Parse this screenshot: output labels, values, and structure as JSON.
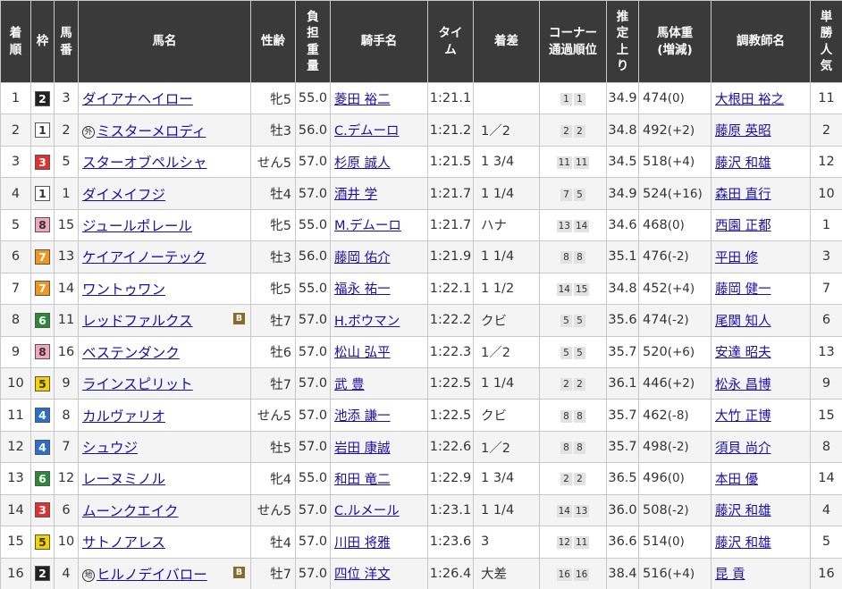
{
  "columns": [
    {
      "label": "着\n順"
    },
    {
      "label": "枠"
    },
    {
      "label": "馬\n番"
    },
    {
      "label": "馬名"
    },
    {
      "label": "性齢"
    },
    {
      "label": "負\n担\n重\n量"
    },
    {
      "label": "騎手名"
    },
    {
      "label": "タイ\nム"
    },
    {
      "label": "着差"
    },
    {
      "label": "コーナー\n通過順位"
    },
    {
      "label": "推\n定\n上\nり"
    },
    {
      "label": "馬体重\n(増減)"
    },
    {
      "label": "調教師名"
    },
    {
      "label": "単\n勝\n人\n気"
    }
  ],
  "frame_colors": {
    "1": {
      "bg": "#ffffff",
      "fg": "#333333"
    },
    "2": {
      "bg": "#222222",
      "fg": "#ffffff"
    },
    "3": {
      "bg": "#e03030",
      "fg": "#ffffff"
    },
    "4": {
      "bg": "#2a70c8",
      "fg": "#ffffff"
    },
    "5": {
      "bg": "#f2d300",
      "fg": "#333333"
    },
    "6": {
      "bg": "#2a8a3a",
      "fg": "#ffffff"
    },
    "7": {
      "bg": "#f0961e",
      "fg": "#ffffff"
    },
    "8": {
      "bg": "#f5a6bf",
      "fg": "#333333"
    }
  },
  "rows": [
    {
      "rank": "1",
      "frame": "2",
      "num": "3",
      "mark": "",
      "horse": "ダイアナヘイロー",
      "blinker": "",
      "sexage": "牝5",
      "weight": "55.0",
      "jockey": "菱田 裕二",
      "time": "1:21.1",
      "diff": "",
      "corner": [
        "1",
        "1"
      ],
      "last3f": "34.9",
      "body": "474",
      "bodydiff": "(0)",
      "trainer": "大根田 裕之",
      "pop": "11"
    },
    {
      "rank": "2",
      "frame": "1",
      "num": "2",
      "mark": "外",
      "horse": "ミスターメロディ",
      "blinker": "",
      "sexage": "牡3",
      "weight": "56.0",
      "jockey": "C.デムーロ",
      "time": "1:21.2",
      "diff": "1／2",
      "corner": [
        "2",
        "2"
      ],
      "last3f": "34.8",
      "body": "492",
      "bodydiff": "(+2)",
      "trainer": "藤原 英昭",
      "pop": "2"
    },
    {
      "rank": "3",
      "frame": "3",
      "num": "5",
      "mark": "",
      "horse": "スターオブペルシャ",
      "blinker": "",
      "sexage": "せん5",
      "weight": "57.0",
      "jockey": "杉原 誠人",
      "time": "1:21.5",
      "diff": "1 3/4",
      "corner": [
        "11",
        "11"
      ],
      "last3f": "34.5",
      "body": "518",
      "bodydiff": "(+4)",
      "trainer": "藤沢 和雄",
      "pop": "12"
    },
    {
      "rank": "4",
      "frame": "1",
      "num": "1",
      "mark": "",
      "horse": "ダイメイフジ",
      "blinker": "",
      "sexage": "牡4",
      "weight": "57.0",
      "jockey": "酒井 学",
      "time": "1:21.7",
      "diff": "1 1/4",
      "corner": [
        "7",
        "5"
      ],
      "last3f": "34.9",
      "body": "524",
      "bodydiff": "(+16)",
      "trainer": "森田 直行",
      "pop": "10"
    },
    {
      "rank": "5",
      "frame": "8",
      "num": "15",
      "mark": "",
      "horse": "ジュールポレール",
      "blinker": "",
      "sexage": "牝5",
      "weight": "55.0",
      "jockey": "M.デムーロ",
      "time": "1:21.7",
      "diff": "ハナ",
      "corner": [
        "13",
        "14"
      ],
      "last3f": "34.6",
      "body": "468",
      "bodydiff": "(0)",
      "trainer": "西園 正都",
      "pop": "1"
    },
    {
      "rank": "6",
      "frame": "7",
      "num": "13",
      "mark": "",
      "horse": "ケイアイノーテック",
      "blinker": "",
      "sexage": "牡3",
      "weight": "56.0",
      "jockey": "藤岡 佑介",
      "time": "1:21.9",
      "diff": "1 1/4",
      "corner": [
        "8",
        "8"
      ],
      "last3f": "35.1",
      "body": "476",
      "bodydiff": "(-2)",
      "trainer": "平田 修",
      "pop": "3"
    },
    {
      "rank": "7",
      "frame": "7",
      "num": "14",
      "mark": "",
      "horse": "ワントゥワン",
      "blinker": "",
      "sexage": "牝5",
      "weight": "55.0",
      "jockey": "福永 祐一",
      "time": "1:22.1",
      "diff": "1 1/2",
      "corner": [
        "14",
        "15"
      ],
      "last3f": "34.8",
      "body": "452",
      "bodydiff": "(+4)",
      "trainer": "藤岡 健一",
      "pop": "7"
    },
    {
      "rank": "8",
      "frame": "6",
      "num": "11",
      "mark": "",
      "horse": "レッドファルクス",
      "blinker": "B",
      "sexage": "牡7",
      "weight": "57.0",
      "jockey": "H.ボウマン",
      "time": "1:22.2",
      "diff": "クビ",
      "corner": [
        "5",
        "5"
      ],
      "last3f": "35.6",
      "body": "474",
      "bodydiff": "(-2)",
      "trainer": "尾関 知人",
      "pop": "6"
    },
    {
      "rank": "9",
      "frame": "8",
      "num": "16",
      "mark": "",
      "horse": "ベステンダンク",
      "blinker": "",
      "sexage": "牡6",
      "weight": "57.0",
      "jockey": "松山 弘平",
      "time": "1:22.3",
      "diff": "1／2",
      "corner": [
        "5",
        "5"
      ],
      "last3f": "35.7",
      "body": "520",
      "bodydiff": "(+6)",
      "trainer": "安達 昭夫",
      "pop": "13"
    },
    {
      "rank": "10",
      "frame": "5",
      "num": "9",
      "mark": "",
      "horse": "ラインスピリット",
      "blinker": "",
      "sexage": "牡7",
      "weight": "57.0",
      "jockey": "武 豊",
      "time": "1:22.5",
      "diff": "1 1/4",
      "corner": [
        "2",
        "2"
      ],
      "last3f": "36.1",
      "body": "446",
      "bodydiff": "(+2)",
      "trainer": "松永 昌博",
      "pop": "9"
    },
    {
      "rank": "11",
      "frame": "4",
      "num": "8",
      "mark": "",
      "horse": "カルヴァリオ",
      "blinker": "",
      "sexage": "せん5",
      "weight": "57.0",
      "jockey": "池添 謙一",
      "time": "1:22.5",
      "diff": "クビ",
      "corner": [
        "8",
        "8"
      ],
      "last3f": "35.7",
      "body": "462",
      "bodydiff": "(-8)",
      "trainer": "大竹 正博",
      "pop": "15"
    },
    {
      "rank": "12",
      "frame": "4",
      "num": "7",
      "mark": "",
      "horse": "シュウジ",
      "blinker": "",
      "sexage": "牡5",
      "weight": "57.0",
      "jockey": "岩田 康誠",
      "time": "1:22.6",
      "diff": "1／2",
      "corner": [
        "8",
        "8"
      ],
      "last3f": "35.7",
      "body": "498",
      "bodydiff": "(-2)",
      "trainer": "須貝 尚介",
      "pop": "8"
    },
    {
      "rank": "13",
      "frame": "6",
      "num": "12",
      "mark": "",
      "horse": "レーヌミノル",
      "blinker": "",
      "sexage": "牝4",
      "weight": "55.0",
      "jockey": "和田 竜二",
      "time": "1:22.9",
      "diff": "1 3/4",
      "corner": [
        "2",
        "2"
      ],
      "last3f": "36.5",
      "body": "496",
      "bodydiff": "(0)",
      "trainer": "本田 優",
      "pop": "14"
    },
    {
      "rank": "14",
      "frame": "3",
      "num": "6",
      "mark": "",
      "horse": "ムーンクエイク",
      "blinker": "",
      "sexage": "せん5",
      "weight": "57.0",
      "jockey": "C.ルメール",
      "time": "1:23.1",
      "diff": "1 1/4",
      "corner": [
        "14",
        "13"
      ],
      "last3f": "36.0",
      "body": "508",
      "bodydiff": "(-2)",
      "trainer": "藤沢 和雄",
      "pop": "4"
    },
    {
      "rank": "15",
      "frame": "5",
      "num": "10",
      "mark": "",
      "horse": "サトノアレス",
      "blinker": "",
      "sexage": "牡4",
      "weight": "57.0",
      "jockey": "川田 将雅",
      "time": "1:23.6",
      "diff": "3",
      "corner": [
        "12",
        "11"
      ],
      "last3f": "36.6",
      "body": "514",
      "bodydiff": "(0)",
      "trainer": "藤沢 和雄",
      "pop": "5"
    },
    {
      "rank": "16",
      "frame": "2",
      "num": "4",
      "mark": "地",
      "horse": "ヒルノデイバロー",
      "blinker": "B",
      "sexage": "牡7",
      "weight": "57.0",
      "jockey": "四位 洋文",
      "time": "1:26.4",
      "diff": "大差",
      "corner": [
        "16",
        "16"
      ],
      "last3f": "38.4",
      "body": "516",
      "bodydiff": "(+4)",
      "trainer": "昆 貢",
      "pop": "16"
    }
  ]
}
